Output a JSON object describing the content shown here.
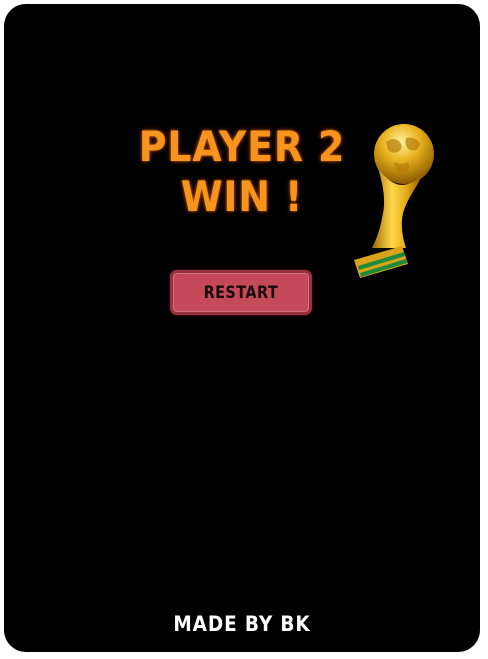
{
  "result": {
    "line1": "PLAYER 2",
    "line2": "WIN !"
  },
  "trophy": {
    "icon": "world-cup-trophy-icon",
    "gold": "#e8b21c",
    "band_green": "#1f8a3a"
  },
  "restart": {
    "label": "RESTART",
    "color": "#c44a5a"
  },
  "footer": {
    "credit": "MADE BY BK"
  },
  "colors": {
    "background": "#000000",
    "title": "#f7941d"
  }
}
